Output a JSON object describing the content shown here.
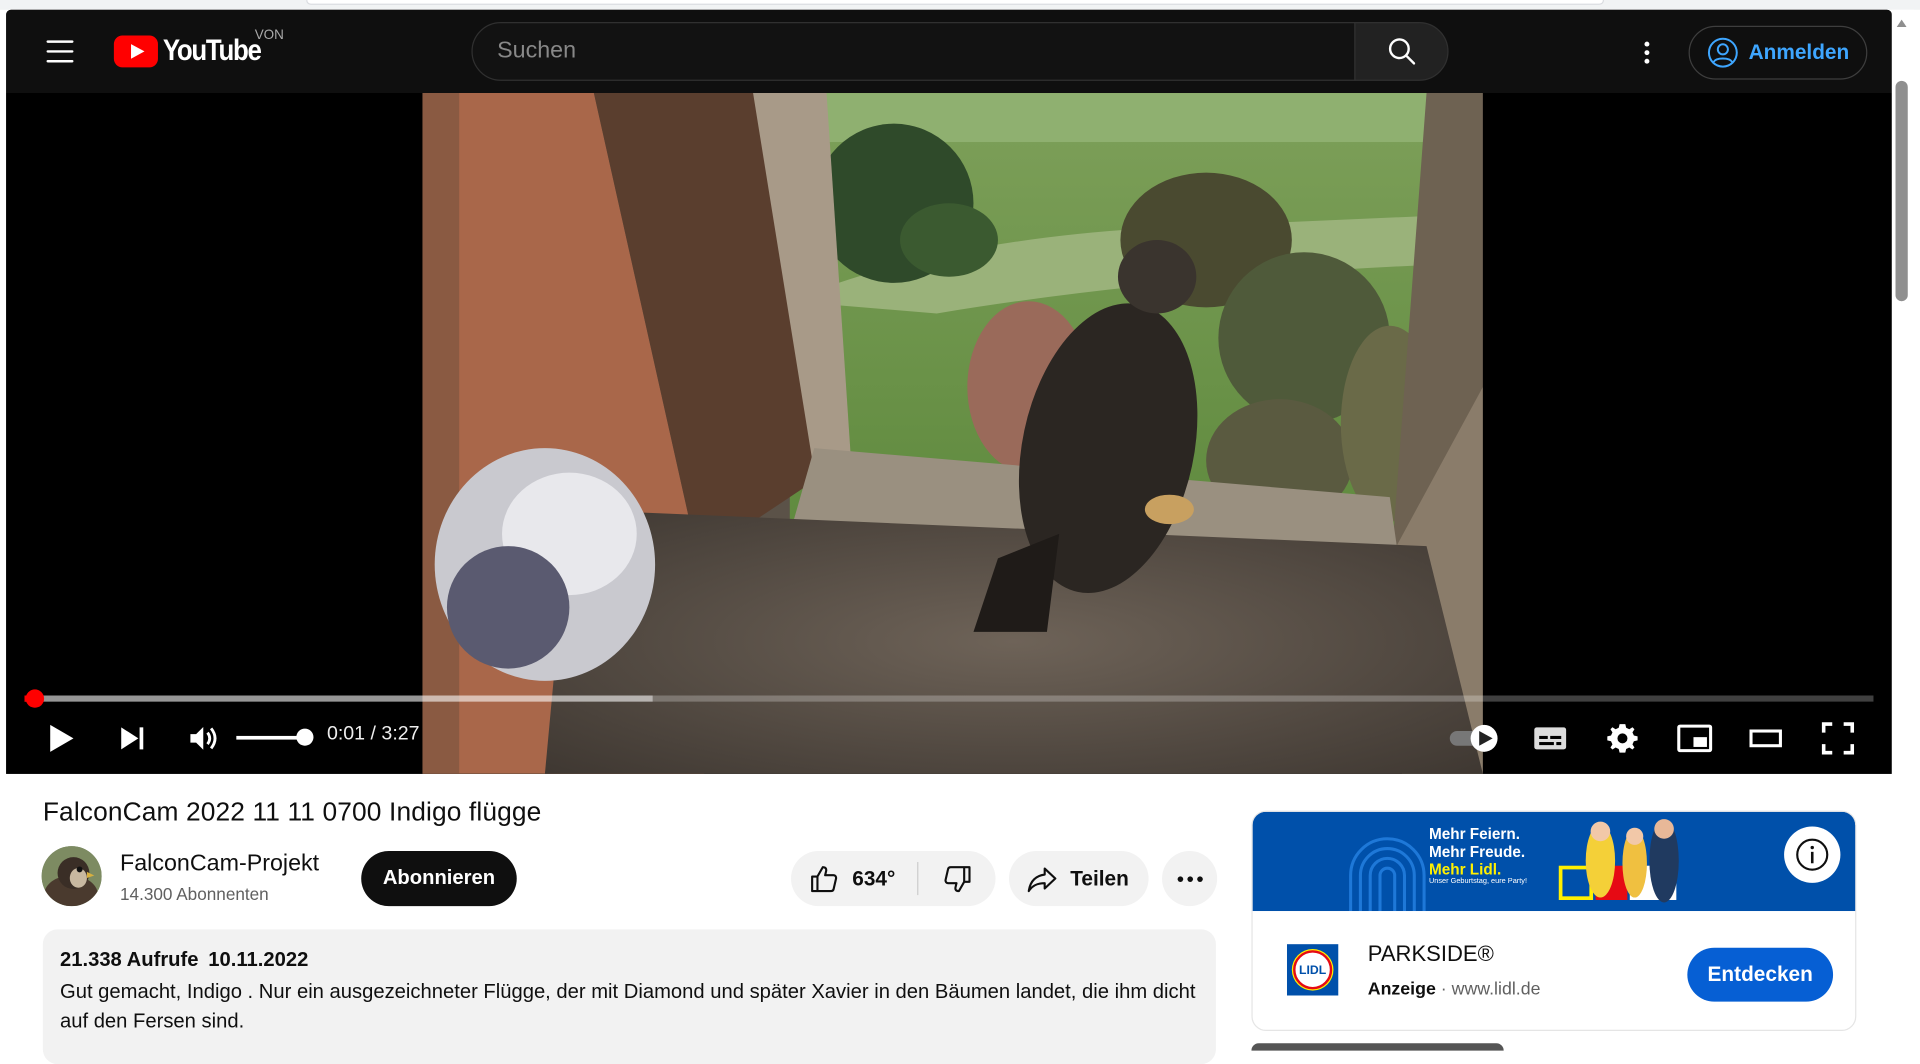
{
  "header": {
    "logo_text": "YouTube",
    "region_code": "VON",
    "search_placeholder": "Suchen",
    "signin_label": "Anmelden"
  },
  "player": {
    "time_current": "0:01",
    "time_separator": "/",
    "time_total": "3:27",
    "progress_fraction": 0.0053,
    "buffered_fraction": 0.34,
    "volume_fraction": 1.0
  },
  "video": {
    "title": "FalconCam 2022 11 11 0700 Indigo flügge",
    "channel_name": "FalconCam-Projekt",
    "subscribers": "14.300 Abonnenten",
    "subscribe_label": "Abonnieren",
    "like_count": "634°",
    "share_label": "Teilen"
  },
  "description": {
    "views": "21.338 Aufrufe",
    "date": "10.11.2022",
    "text": "Gut gemacht, Indigo . Nur ein ausgezeichneter Flügge, der mit Diamond und später Xavier in den Bäumen landet, die ihm dicht auf den Fersen sind."
  },
  "ad": {
    "banner_line1": "Mehr Feiern.",
    "banner_line2": "Mehr Freude.",
    "banner_line3": "Mehr Lidl.",
    "banner_small": "Unser Geburtstag, eure Party!",
    "logo_text": "LIDL",
    "title": "PARKSIDE®",
    "label": "Anzeige",
    "separator": "·",
    "domain": "www.lidl.de",
    "cta_label": "Entdecken"
  },
  "colors": {
    "brand_red": "#ff0000",
    "link_blue": "#3ea6ff",
    "cta_blue": "#065fd4",
    "lidl_blue": "#0050aa",
    "lidl_yellow": "#fff000"
  }
}
